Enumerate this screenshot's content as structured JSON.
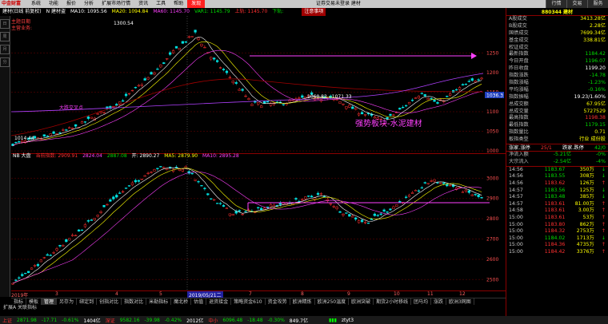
{
  "menubar": {
    "logo": "中金财富",
    "items": [
      "系统",
      "功能",
      "报价",
      "分析",
      "扩展市场行情",
      "资讯",
      "工具",
      "帮助",
      "发现"
    ],
    "active": "发现",
    "center": "证券交易未登录  建材",
    "right": [
      "行情",
      "交易",
      "服务"
    ]
  },
  "tabs": {
    "title": "建材(日线 前复权)",
    "indicator": "N 建材盗",
    "ma10": "MA10: 1095.56",
    "ma20": "MA20: 1094.84",
    "ma60": "MA60: 1145.70",
    "var1": "VAR1: 1145.79",
    "upper": "上轨: 1145.70",
    "lower": "下轨:",
    "flag": "注意事项"
  },
  "main_legend": {
    "line1": "主题日期",
    "line2": "主营业务:"
  },
  "left_buttons": [
    "日",
    "周",
    "月",
    "分"
  ],
  "price_chart": {
    "y_ticks": [
      "1250",
      "1200",
      "1150",
      "1100",
      "1050",
      "1000"
    ],
    "high_label": "1300.54",
    "low_label": "1060.83 - 1071.33",
    "price_tag": "1036.3",
    "cross_label": "大跌交叉点",
    "annotation": "强势板块-水泥建材",
    "start_label": "1014.44"
  },
  "index_chart": {
    "name": "NB 大盘",
    "current": "当前指数: 2909.91",
    "v1": "2824.04",
    "v2": "2887.08",
    "open": "开: 2890.27",
    "ma5": "MA5: 2879.90",
    "ma10": "MA10: 2895.28",
    "y_ticks": [
      "3000",
      "2900",
      "2800",
      "2700",
      "2600",
      "2500"
    ]
  },
  "x_axis": {
    "labels": [
      "2019年",
      "3",
      "4",
      "5",
      "2019/05/21二",
      "7",
      "8",
      "9",
      "10",
      "11",
      "12"
    ]
  },
  "bottom_tabs": [
    "指标",
    "模板",
    "管理",
    "另存为",
    "绑定到",
    "创指对比",
    "指数对比",
    "米勒指标",
    "魔北桥",
    "估值",
    "退资接金",
    "策略资金610",
    "资金攻势",
    "欧洲精炼",
    "欧洲250温度",
    "欧洲突破",
    "期货2小时移线",
    "团马均",
    "涨跌",
    "欧洲3网图"
  ],
  "bottom_active": "管理",
  "extra_row": "扩展A  关联指标",
  "status": {
    "sh": {
      "name": "上证",
      "val": "2871.98",
      "chg": "-17.71",
      "pct": "-0.61%",
      "amt": "1404亿"
    },
    "sz": {
      "name": "深证",
      "val": "9582.16",
      "chg": "-39.98",
      "pct": "-0.42%",
      "amt": "2012亿"
    },
    "zx": {
      "name": "中小",
      "val": "6096.48",
      "chg": "-18.48",
      "pct": "-0.30%",
      "amt": "849.7亿"
    },
    "user": "ztyt3"
  },
  "right_panel": {
    "title": "880344 建材",
    "rows1": [
      {
        "k": "A股成交",
        "v": "3413.28亿",
        "c": "#ffff00"
      },
      {
        "k": "B股成交",
        "v": "2.28亿",
        "c": "#ffff00"
      },
      {
        "k": "国债成交",
        "v": "7699.34亿",
        "c": "#ffff00"
      },
      {
        "k": "基金成交",
        "v": "338.81亿",
        "c": "#ffff00"
      },
      {
        "k": "权证成交",
        "v": "",
        "c": "#ffff00"
      },
      {
        "k": "最新指数",
        "v": "1184.42",
        "c": "#00dd00"
      },
      {
        "k": "今日开盘",
        "v": "1196.07",
        "c": "#00dd00"
      },
      {
        "k": "昨日收盘",
        "v": "1199.20",
        "c": "#ffffff"
      },
      {
        "k": "指数涨跌",
        "v": "-14.78",
        "c": "#00dd00"
      },
      {
        "k": "指数涨幅",
        "v": "-1.23%",
        "c": "#00dd00"
      },
      {
        "k": "平均涨幅",
        "v": "-0.16%",
        "c": "#00dd00"
      },
      {
        "k": "指数振幅",
        "v": "19.23/1.60%",
        "c": "#ffffff"
      },
      {
        "k": "总成交额",
        "v": "67.95亿",
        "c": "#ffff00"
      },
      {
        "k": "总成交量",
        "v": "5727529",
        "c": "#ffff00"
      },
      {
        "k": "最高指数",
        "v": "1198.38",
        "c": "#ff3030"
      },
      {
        "k": "最低指数",
        "v": "1179.15",
        "c": "#00dd00"
      },
      {
        "k": "指数量比",
        "v": "0.71",
        "c": "#ffff00"
      },
      {
        "k": "板指类型",
        "v": "行业 成份股",
        "c": "#ffff00"
      }
    ],
    "limit": {
      "label": "涨家.涨停",
      "a": "25/1",
      "mid": "跌家.跌停",
      "b": "42/0"
    },
    "flows": [
      {
        "k": "净流入额",
        "v": "-5.21亿",
        "p": "-0%"
      },
      {
        "k": "大宗流入",
        "v": "-2.54亿",
        "p": "-4%"
      }
    ],
    "ticks": [
      [
        "14:56",
        "1183.67",
        "350万",
        "↓"
      ],
      [
        "14:56",
        "1183.55",
        "308万",
        "↓"
      ],
      [
        "14:56",
        "1183.62",
        "126万",
        "↑"
      ],
      [
        "14:57",
        "1183.56",
        "125万",
        "↓"
      ],
      [
        "14:57",
        "1183.48",
        "385万",
        "↓"
      ],
      [
        "14:57",
        "1183.61",
        "81.00万",
        "↑"
      ],
      [
        "14:58",
        "1183.61",
        "3.00万",
        "↑"
      ],
      [
        "15:00",
        "1183.61",
        "53万",
        "↑"
      ],
      [
        "15:00",
        "1183.80",
        "862万",
        "↑"
      ],
      [
        "15:00",
        "1184.32",
        "2753万",
        "↑"
      ],
      [
        "15:00",
        "1184.02",
        "1713万",
        "↓"
      ],
      [
        "15:00",
        "1184.36",
        "4735万",
        "↑"
      ],
      [
        "15:00",
        "1184.42",
        "3376万",
        "↑"
      ]
    ]
  }
}
